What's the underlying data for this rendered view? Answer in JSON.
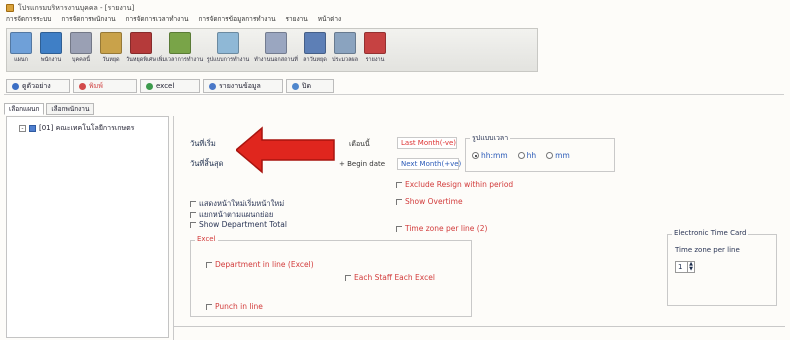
{
  "window": {
    "title": "โปรแกรมบริหารงานบุคคล - [รายงาน]"
  },
  "menubar": [
    "การจัดการระบบ",
    "การจัดการพนักงาน",
    "การจัดการเวลาทำงาน",
    "การจัดการข้อมูลการทำงาน",
    "รายงาน",
    "หน้าต่าง"
  ],
  "toolbar": [
    {
      "label": "แผนก",
      "color": "#6fa0d8",
      "wide": false
    },
    {
      "label": "พนักงาน",
      "color": "#3f7fc6",
      "wide": false
    },
    {
      "label": "บุคคลนี้",
      "color": "#9aa0b4",
      "wide": false
    },
    {
      "label": "วันหยุด",
      "color": "#c9a24a",
      "wide": false
    },
    {
      "label": "วันหยุดพิเศษ",
      "color": "#b53a3a",
      "wide": false
    },
    {
      "label": "เพิ่มเวลาการทำงาน",
      "color": "#79a448",
      "wide": true
    },
    {
      "label": "รูปแบบการทำงาน",
      "color": "#8fb8d6",
      "wide": true
    },
    {
      "label": "ทำงานนอกสถานที่",
      "color": "#9aa6c0",
      "wide": true
    },
    {
      "label": "ลาวันหยุด",
      "color": "#5d7fb6",
      "wide": false
    },
    {
      "label": "ประมวลผล",
      "color": "#8aa3bf",
      "wide": false
    },
    {
      "label": "รายงาน",
      "color": "#c64242",
      "wide": false
    }
  ],
  "buttons": {
    "preview": {
      "label": "ดูตัวอย่าง",
      "color": "#3b6ec4"
    },
    "print": {
      "label": "พิมพ์",
      "color": "#d24a4a"
    },
    "excel": {
      "label": "excel",
      "color": "#3c9a4c"
    },
    "summary": {
      "label": "รายงานข้อมูล",
      "color": "#4a78c8"
    },
    "close": {
      "label": "ปิด",
      "color": "#4f86cc"
    }
  },
  "subtabs": [
    "เลือกแผนก",
    "เลือกพนักงาน"
  ],
  "tree": {
    "expander": "-",
    "item": "[01] คณะเทคโนโลยีการเกษตร"
  },
  "form": {
    "start_date_label": "วันที่เริ่ม",
    "end_date_label": "วันที่สิ้นสุด",
    "month_label": "เดือนนี้",
    "last_month": "Last Month(-ve)",
    "begin_date": "+ Begin date",
    "next_month": "Next Month(+ve)",
    "format_title": "รูปแบบเวลา",
    "format_options": [
      {
        "label": "hh:mm",
        "selected": true
      },
      {
        "label": "hh",
        "selected": false
      },
      {
        "label": "mm",
        "selected": false
      }
    ],
    "checks_left": [
      {
        "label": "แสดงหน้าใหม่เริ่มหน้าใหม่",
        "style": "dark"
      },
      {
        "label": "แยกหน้าตามแผนกย่อย",
        "style": "dark"
      },
      {
        "label": "Show Department Total",
        "style": "dark"
      }
    ],
    "checks_mid": [
      {
        "label": "Exclude Resign within period",
        "style": "red"
      },
      {
        "label": "Show Overtime",
        "style": "red"
      },
      {
        "label": "Time zone per line (2)",
        "style": "red"
      }
    ],
    "excel_group": {
      "title": "Excel",
      "dept_in_line": "Department in line (Excel)",
      "each_staff": "Each Staff Each Excel",
      "punch_in_line": "Punch in line"
    },
    "etc_group": {
      "title": "Electronic Time Card",
      "label": "Time zone per line",
      "value": "1"
    }
  }
}
